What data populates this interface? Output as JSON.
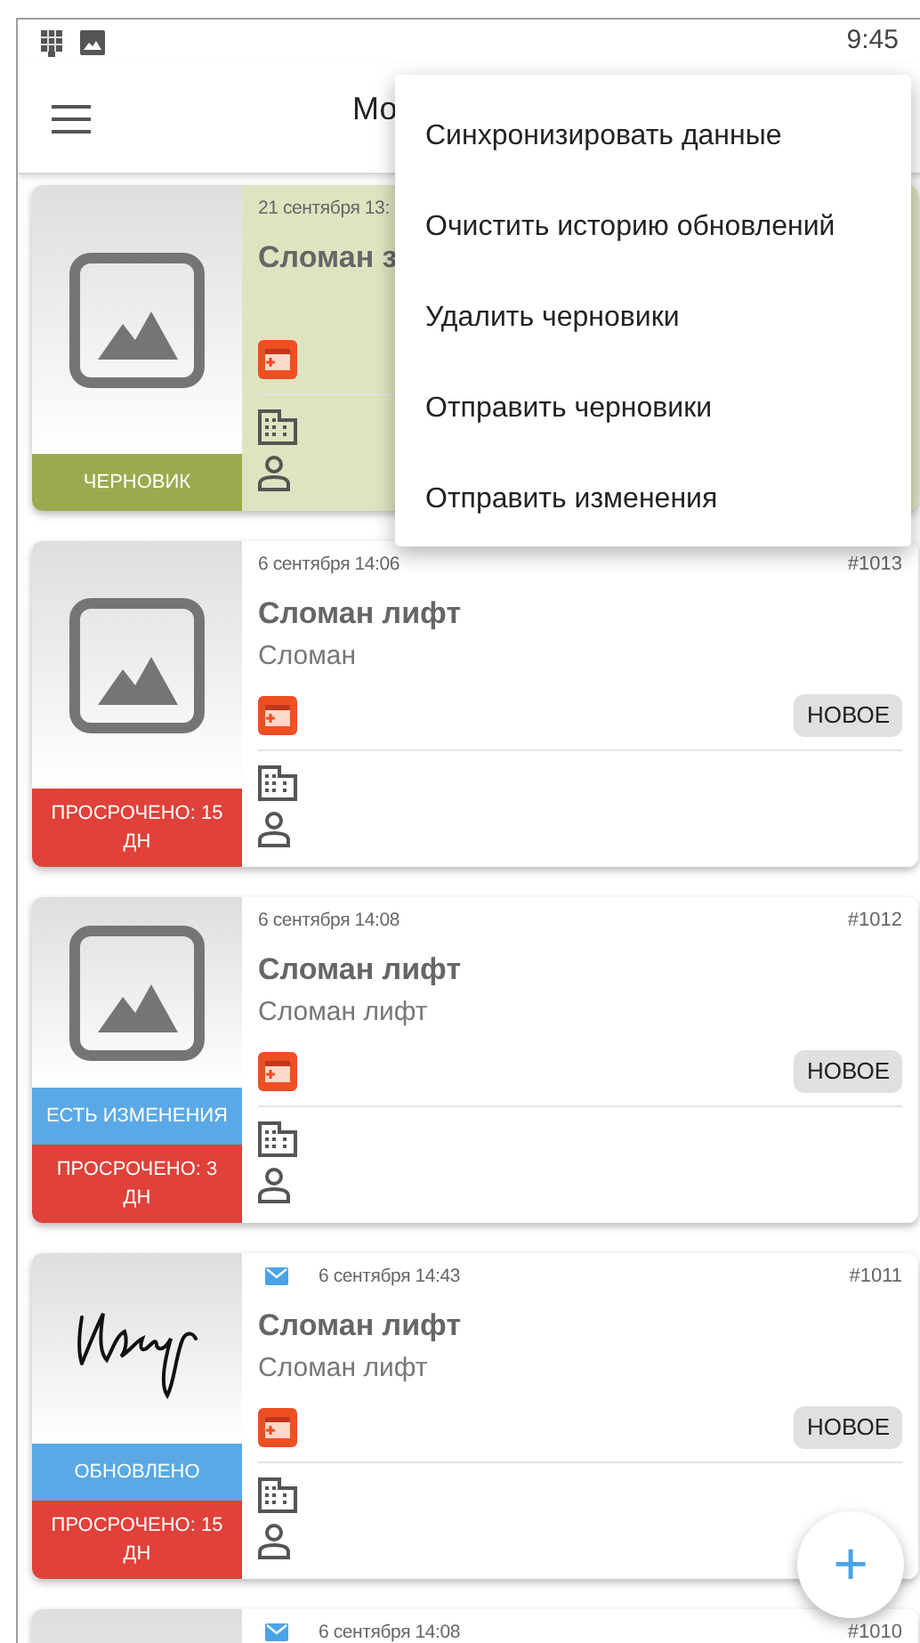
{
  "status_bar": {
    "time": "9:45"
  },
  "app_bar": {
    "title": "Мо"
  },
  "menu": {
    "items": [
      "Синхронизировать данные",
      "Очистить историю обновлений",
      "Удалить черновики",
      "Отправить черновики",
      "Отправить изменения"
    ]
  },
  "cards": [
    {
      "kind": "image",
      "highlighted": true,
      "mail": false,
      "date": "21 сентября 13:",
      "title": "Сломан з",
      "statuses": [
        {
          "kind": "draft",
          "label": "ЧЕРНОВИК"
        }
      ]
    },
    {
      "kind": "image",
      "highlighted": false,
      "mail": false,
      "date": "6 сентября 14:06",
      "number": "#1013",
      "title": "Сломан лифт",
      "description": "Сломан",
      "badge": "НОВОЕ",
      "statuses": [
        {
          "kind": "overdue",
          "label": "ПРОСРОЧЕНО: 15 ДН"
        }
      ]
    },
    {
      "kind": "image",
      "highlighted": false,
      "mail": false,
      "date": "6 сентября 14:08",
      "number": "#1012",
      "title": "Сломан лифт",
      "description": "Сломан лифт",
      "badge": "НОВОЕ",
      "statuses": [
        {
          "kind": "changed",
          "label": "ЕСТЬ ИЗМЕНЕНИЯ"
        },
        {
          "kind": "overdue",
          "label": "ПРОСРОЧЕНО: 3 ДН"
        }
      ]
    },
    {
      "kind": "signature",
      "highlighted": false,
      "mail": true,
      "date": "6 сентября 14:43",
      "number": "#1011",
      "title": "Сломан лифт",
      "description": "Сломан лифт",
      "badge": "НОВОЕ",
      "statuses": [
        {
          "kind": "updated",
          "label": "ОБНОВЛЕНО"
        },
        {
          "kind": "overdue",
          "label": "ПРОСРОЧЕНО: 15 ДН"
        }
      ]
    },
    {
      "kind": "image",
      "highlighted": false,
      "mail": true,
      "date": "6 сентября 14:08",
      "number": "#1010"
    }
  ],
  "fab": {
    "label": "+"
  }
}
